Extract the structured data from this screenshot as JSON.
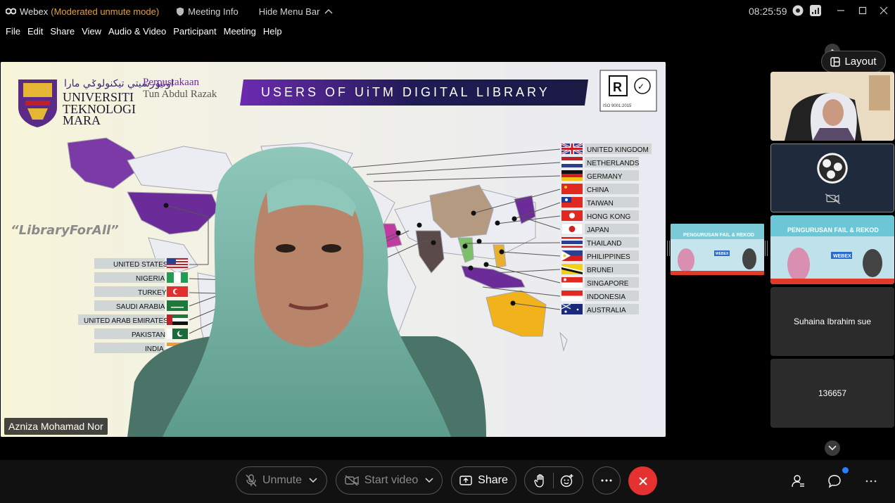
{
  "titlebar": {
    "app_name": "Webex",
    "mode": "(Moderated unmute mode)",
    "meeting_info": "Meeting Info",
    "hide_menu": "Hide Menu Bar",
    "clock": "08:25:59"
  },
  "menu": [
    "File",
    "Edit",
    "Share",
    "View",
    "Audio & Video",
    "Participant",
    "Meeting",
    "Help"
  ],
  "slide": {
    "uni_jawi": "اونيۏرسيتي تيكنولوݢي مارا",
    "uni_line1": "UNIVERSITI",
    "uni_line2": "TEKNOLOGI",
    "uni_line3": "MARA",
    "library_line1": "Perpustakaan",
    "library_line2": "Tun Abdul Razak",
    "title": "USERS OF UiTM DIGITAL LIBRARY",
    "hashtag": "“LibraryForAll”",
    "left_countries": [
      "UNITED STATES",
      "NIGERIA",
      "TURKEY",
      "SAUDI ARABIA",
      "UNITED ARAB EMIRATES",
      "PAKISTAN",
      "INDIA"
    ],
    "right_countries": [
      "UNITED KINGDOM",
      "NETHERLANDS",
      "GERMANY",
      "CHINA",
      "TAIWAN",
      "HONG KONG",
      "JAPAN",
      "THAILAND",
      "PHILIPPINES",
      "BRUNEI",
      "SINGAPORE",
      "INDONESIA",
      "AUSTRALIA"
    ],
    "cert_text": "ISO 9001:2015",
    "cert_badge": "✓"
  },
  "presenter_name": "Azniza Mohamad Nor",
  "layout_label": "Layout",
  "poster": {
    "heading": "PENGURUSAN FAIL & REKOD",
    "badge": "WEBEX"
  },
  "tiles": [
    {
      "name": "Suhaina Ibrahim sue"
    },
    {
      "name": "136657"
    }
  ],
  "controls": {
    "unmute": "Unmute",
    "start_video": "Start video",
    "share": "Share"
  },
  "colors": {
    "accent_end": "#e5312f",
    "badge_blue": "#2a7fff",
    "map_purple": "#6b2c9a"
  }
}
